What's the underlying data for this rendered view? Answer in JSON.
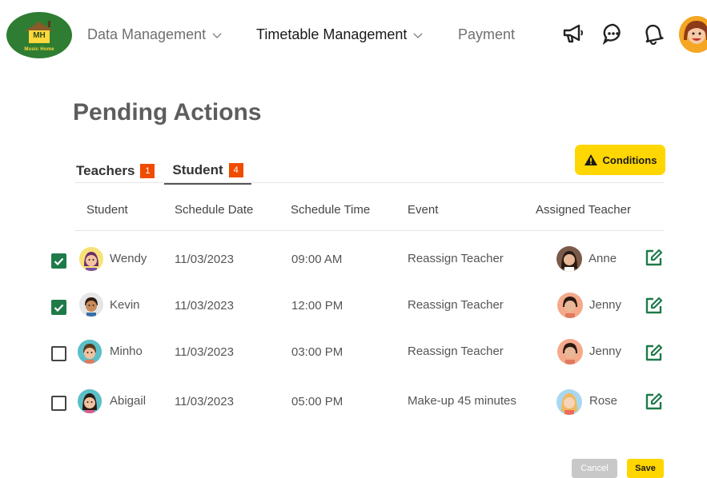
{
  "logo": {
    "initials": "MH",
    "subtitle": "Music Home"
  },
  "nav": [
    {
      "label": "Data Management",
      "has_dropdown": true,
      "active": false
    },
    {
      "label": "Timetable Management",
      "has_dropdown": true,
      "active": true
    },
    {
      "label": "Payment",
      "has_dropdown": false,
      "active": false
    }
  ],
  "header_icons": [
    "megaphone-icon",
    "chat-bubble-icon",
    "bell-icon",
    "profile-avatar"
  ],
  "page_title": "Pending Actions",
  "tabs": [
    {
      "label": "Teachers",
      "count": "1",
      "active": false
    },
    {
      "label": "Student",
      "count": "4",
      "active": true
    }
  ],
  "conditions_button": {
    "label": "Conditions",
    "icon": "warning-icon"
  },
  "table": {
    "columns": [
      "Student",
      "Schedule Date",
      "Schedule Time",
      "Event",
      "Assigned Teacher"
    ],
    "rows": [
      {
        "checked": true,
        "student": "Wendy",
        "date": "11/03/2023",
        "time": "09:00 AM",
        "event": "Reassign Teacher",
        "teacher": "Anne"
      },
      {
        "checked": true,
        "student": "Kevin",
        "date": "11/03/2023",
        "time": "12:00 PM",
        "event": "Reassign Teacher",
        "teacher": "Jenny"
      },
      {
        "checked": false,
        "student": "Minho",
        "date": "11/03/2023",
        "time": "03:00 PM",
        "event": "Reassign Teacher",
        "teacher": "Jenny"
      },
      {
        "checked": false,
        "student": "Abigail",
        "date": "11/03/2023",
        "time": "05:00 PM",
        "event": "Make-up 45 minutes",
        "teacher": "Rose"
      }
    ]
  },
  "footer": {
    "cancel_label": "Cancel",
    "save_label": "Save"
  },
  "colors": {
    "accent": "#ffd600",
    "badge": "#f04c00",
    "check": "#1f7a4a",
    "logo_bg": "#2e7d32"
  }
}
